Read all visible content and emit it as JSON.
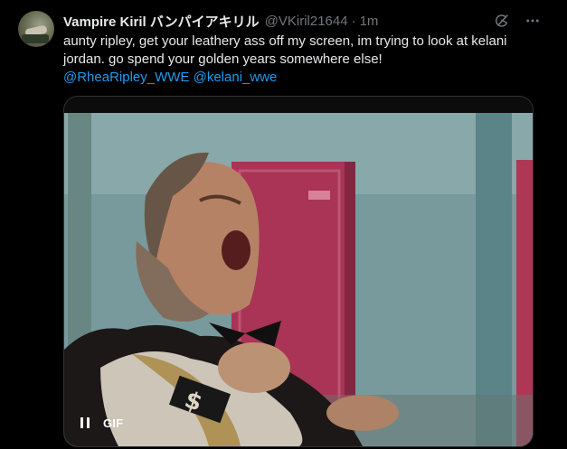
{
  "tweet": {
    "display_name": "Vampire Kiril バンパイアキリル",
    "handle": "@VKiril21644",
    "separator": "·",
    "time": "1m",
    "text_line1": "aunty ripley, get your leathery ass off my screen, im trying to look at kelani",
    "text_line2": "jordan. go spend your golden years somewhere else!",
    "mentions": [
      "@RheaRipley_WWE",
      "@kelani_wwe"
    ]
  },
  "media": {
    "badge": "GIF",
    "icons": [
      "pause-icon"
    ]
  },
  "icons": {
    "grok": "grok-icon",
    "more": "more-icon"
  }
}
